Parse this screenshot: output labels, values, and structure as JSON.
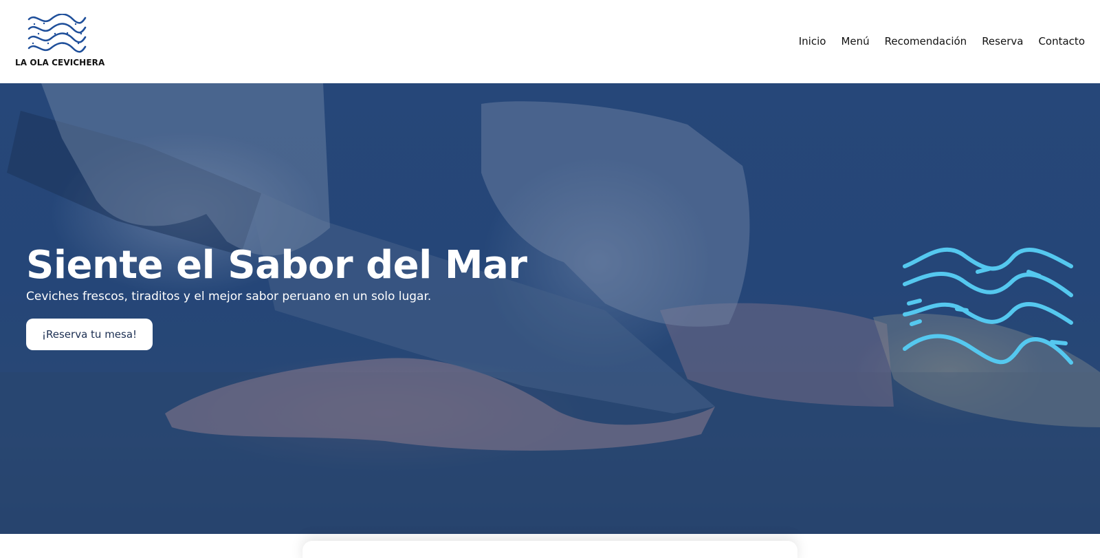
{
  "brand": {
    "name": "LA OLA CEVICHERA",
    "logo_icon": "wave-logo-icon",
    "logo_color": "#1f4f9a"
  },
  "nav": {
    "items": [
      {
        "label": "Inicio"
      },
      {
        "label": "Menú"
      },
      {
        "label": "Recomendación"
      },
      {
        "label": "Reserva"
      },
      {
        "label": "Contacto"
      }
    ]
  },
  "hero": {
    "title": "Siente el Sabor del Mar",
    "subtitle": "Ceviches frescos, tiraditos y el mejor sabor peruano en un solo lugar.",
    "cta_label": "¡Reserva tu mesa!",
    "background_image": "chef-slicing-fish-photo",
    "overlay_color": "#2b4d80",
    "decoration_icon": "waves-icon",
    "decoration_color": "#55c8ef"
  }
}
